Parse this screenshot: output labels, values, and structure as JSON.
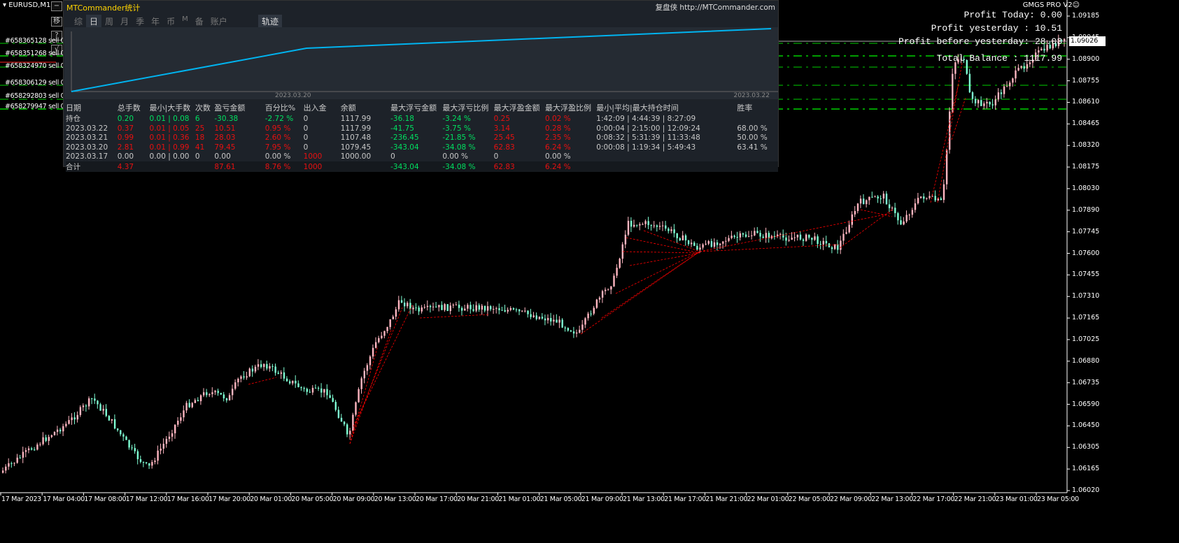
{
  "symbol": "EURUSD,M15",
  "side_buttons": [
    "−",
    "移",
    "?",
    "√"
  ],
  "orders": [
    {
      "label": "#658365128 sell 0.08"
    },
    {
      "label": "#658351268 sell 0.05"
    },
    {
      "label": "#658324970 sell 0.03"
    },
    {
      "label": "#658306129 sell 0.02"
    },
    {
      "label": "#658292803 sell 0.01"
    },
    {
      "label": "#658279947 sell 0.01"
    }
  ],
  "brand": "GMGS PRO V2☺",
  "info": {
    "today": "Profit Today: 0.00",
    "yesterday": "Profit yesterday : 10.51",
    "before": "Profit before yesterday: 28.03",
    "balance": "Total Balance : 1117.99"
  },
  "current_price": "1.09026",
  "panel": {
    "title": "MTCommander统计",
    "link": "复盘侠 http://MTCommander.com",
    "tabs": [
      "综",
      "日",
      "周",
      "月",
      "季",
      "年",
      "币",
      "M",
      "备",
      "账户"
    ],
    "active_tab": "日",
    "track": "轨迹",
    "equity_dates": [
      "2023.03.20",
      "2023.03.22"
    ],
    "headers": [
      "日期",
      "总手数",
      "最小|大手数",
      "次数",
      "盈亏金额",
      "百分比%",
      "出入金",
      "余额",
      "最大浮亏金额",
      "最大浮亏比例",
      "最大浮盈金额",
      "最大浮盈比例",
      "最小|平均|最大持仓时间",
      "胜率"
    ],
    "rows": [
      [
        "持仓",
        "0.20",
        "0.01 | 0.08",
        "6",
        "-30.38",
        "-2.72 %",
        "0",
        "1117.99",
        "-36.18",
        "-3.24 %",
        "0.25",
        "0.02 %",
        "1:42:09 | 4:44:39 | 8:27:09",
        ""
      ],
      [
        "2023.03.22",
        "0.37",
        "0.01 | 0.05",
        "25",
        "10.51",
        "0.95 %",
        "0",
        "1117.99",
        "-41.75",
        "-3.75 %",
        "3.14",
        "0.28 %",
        "0:00:04 | 2:15:00 | 12:09:24",
        "68.00 %"
      ],
      [
        "2023.03.21",
        "0.99",
        "0.01 | 0.36",
        "18",
        "28.03",
        "2.60 %",
        "0",
        "1107.48",
        "-236.45",
        "-21.85 %",
        "25.45",
        "2.35 %",
        "0:08:32 | 5:31:39 | 11:33:48",
        "50.00 %"
      ],
      [
        "2023.03.20",
        "2.81",
        "0.01 | 0.99",
        "41",
        "79.45",
        "7.95 %",
        "0",
        "1079.45",
        "-343.04",
        "-34.08 %",
        "62.83",
        "6.24 %",
        "0:00:08 | 1:19:34 | 5:49:43",
        "63.41 %"
      ],
      [
        "2023.03.17",
        "0.00",
        "0.00 | 0.00",
        "0",
        "0.00",
        "0.00 %",
        "1000",
        "1000.00",
        "0",
        "0.00 %",
        "0",
        "0.00 %",
        "",
        ""
      ]
    ],
    "total": [
      "合计",
      "4.37",
      "",
      "",
      "87.61",
      "8.76 %",
      "1000",
      "",
      "-343.04",
      "-34.08 %",
      "62.83",
      "6.24 %",
      "",
      ""
    ]
  },
  "chart_data": {
    "type": "candlestick",
    "y_ticks": [
      "1.09185",
      "1.09045",
      "1.08900",
      "1.08755",
      "1.08610",
      "1.08465",
      "1.08320",
      "1.08175",
      "1.08030",
      "1.07890",
      "1.07745",
      "1.07600",
      "1.07455",
      "1.07310",
      "1.07165",
      "1.07025",
      "1.06880",
      "1.06735",
      "1.06590",
      "1.06450",
      "1.06305",
      "1.06165",
      "1.06020"
    ],
    "x_ticks": [
      "17 Mar 2023",
      "17 Mar 04:00",
      "17 Mar 08:00",
      "17 Mar 12:00",
      "17 Mar 16:00",
      "17 Mar 20:00",
      "20 Mar 01:00",
      "20 Mar 05:00",
      "20 Mar 09:00",
      "20 Mar 13:00",
      "20 Mar 17:00",
      "20 Mar 21:00",
      "21 Mar 01:00",
      "21 Mar 05:00",
      "21 Mar 09:00",
      "21 Mar 13:00",
      "21 Mar 17:00",
      "21 Mar 21:00",
      "22 Mar 01:00",
      "22 Mar 05:00",
      "22 Mar 09:00",
      "22 Mar 13:00",
      "22 Mar 17:00",
      "22 Mar 21:00",
      "23 Mar 01:00",
      "23 Mar 05:00"
    ],
    "colors": {
      "bull": "#7fffd4",
      "bear": "#ffb6c1",
      "order_line": "#00d000",
      "trade_line": "#ff0000",
      "equity": "#00b4f0"
    }
  }
}
